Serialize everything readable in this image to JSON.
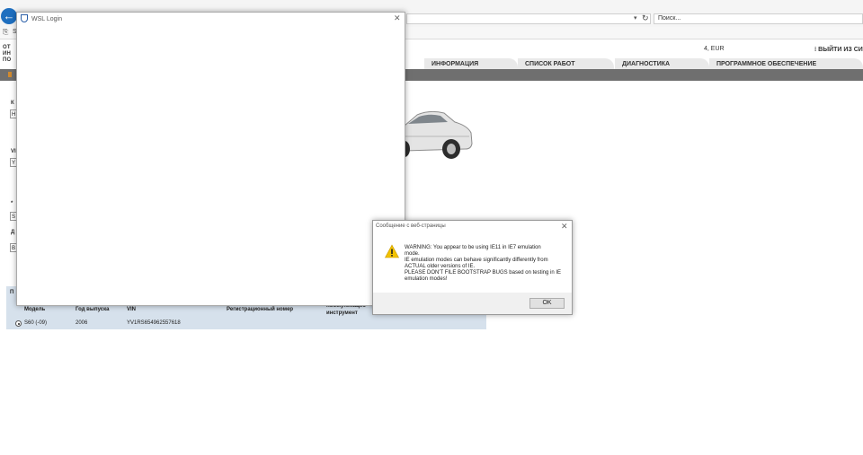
{
  "browser": {
    "search_placeholder": "Поиск...",
    "address_dropdown": "▾",
    "refresh_glyph": "↻",
    "tab_title": "Si",
    "back_glyph": "←"
  },
  "page_header": {
    "left_menu": [
      "ОТ",
      "ИН",
      "ПО"
    ],
    "price_text": "4, EUR",
    "logout_label": "ВЫЙТИ ИЗ СИ"
  },
  "nav_tabs": [
    "ИНФОРМАЦИЯ",
    "СПИСОК РАБОТ",
    "ДИАГНОСТИКА",
    "ПРОГРАММНОЕ ОБЕСПЕЧЕНИЕ"
  ],
  "left_form": {
    "labels": [
      "К",
      "VI",
      "*",
      "Д"
    ],
    "inputs": [
      "Н",
      "Y",
      "S",
      "В"
    ]
  },
  "vehicle_table": {
    "section_label": "П",
    "headers": [
      "Модель",
      "Год выпуска",
      "VIN",
      "Регистрационный номер",
      "Коммуникацио",
      "инструмент"
    ],
    "row": {
      "model": "S60 (-09)",
      "year": "2006",
      "vin": "YV1RS654962557618"
    }
  },
  "wsl_dialog": {
    "title": "WSL Login",
    "close_glyph": "✕"
  },
  "message_dialog": {
    "title": "Сообщение с веб-страницы",
    "close_glyph": "✕",
    "lines": [
      "WARNING: You appear to be using IE11 in IE7 emulation",
      "mode.",
      "IE emulation modes can behave significantly differently from",
      "ACTUAL older versions of IE.",
      "PLEASE DON'T FILE BOOTSTRAP BUGS based on testing in IE",
      "emulation modes!"
    ],
    "ok_label": "OK"
  },
  "colors": {
    "accent_blue": "#1f6fbf",
    "nav_bar": "#6f6f6f",
    "table_bg": "#d6e1ec",
    "warning": "#f2c200"
  }
}
